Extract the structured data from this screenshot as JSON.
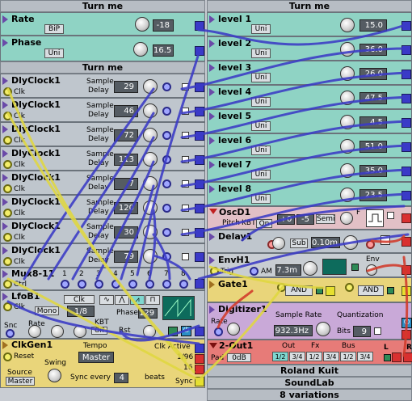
{
  "left_header": "Turn me",
  "right_header": "Turn me",
  "mid_header": "Turn me",
  "rate": {
    "title": "Rate",
    "button": "BiP",
    "value": "-18"
  },
  "phase": {
    "title": "Phase",
    "button": "Uni",
    "value": "16.5"
  },
  "levels": [
    {
      "title": "level 1",
      "button": "Uni",
      "value": "15.0"
    },
    {
      "title": "level 2",
      "button": "Uni",
      "value": "36.0"
    },
    {
      "title": "level 3",
      "button": "Uni",
      "value": "26.0"
    },
    {
      "title": "level 4",
      "button": "Uni",
      "value": "47.5"
    },
    {
      "title": "level 5",
      "button": "Uni",
      "value": "4.5"
    },
    {
      "title": "level 6",
      "button": "Uni",
      "value": "51.0"
    },
    {
      "title": "level 7",
      "button": "Uni",
      "value": "35.0"
    },
    {
      "title": "level 8",
      "button": "Uni",
      "value": "23.5"
    }
  ],
  "dly_clocks": [
    {
      "title": "DlyClock1",
      "clk": "Clk",
      "sample": "Sample",
      "delay": "Delay",
      "value": "29"
    },
    {
      "title": "DlyClock1",
      "clk": "Clk",
      "sample": "Sample",
      "delay": "Delay",
      "value": "46"
    },
    {
      "title": "DlyClock1",
      "clk": "Clk",
      "sample": "Sample",
      "delay": "Delay",
      "value": "72"
    },
    {
      "title": "DlyClock1",
      "clk": "Clk",
      "sample": "Sample",
      "delay": "Delay",
      "value": "113"
    },
    {
      "title": "DlyClock1",
      "clk": "Clk",
      "sample": "Sample",
      "delay": "Delay",
      "value": "7"
    },
    {
      "title": "DlyClock1",
      "clk": "Clk",
      "sample": "Sample",
      "delay": "Delay",
      "value": "120"
    },
    {
      "title": "DlyClock1",
      "clk": "Clk",
      "sample": "Sample",
      "delay": "Delay",
      "value": "30"
    },
    {
      "title": "DlyClock1",
      "clk": "Clk",
      "sample": "Sample",
      "delay": "Delay",
      "value": "79"
    }
  ],
  "mux": {
    "title": "Mux8-11",
    "ctrl": "Ctrl",
    "inputs": [
      "1",
      "2",
      "3",
      "4",
      "5",
      "6",
      "7",
      "8"
    ]
  },
  "lfo": {
    "title": "LfoB1",
    "clk": "Clk",
    "mono": "Mono",
    "rate_val": "1/8",
    "phase_label": "Phase",
    "phase_val": "129",
    "snc": "Snc",
    "rate": "Rate",
    "kbt": "KBT",
    "off": "Off",
    "rst": "Rst"
  },
  "clkgen": {
    "title": "ClkGen1",
    "reset": "Reset",
    "swing": "Swing",
    "tempo": "Tempo",
    "tempo_val": "Master",
    "clk_active": "Clk Active",
    "div": "1/96",
    "div2": "16",
    "source": "Source",
    "source_val": "Master",
    "sync_every": "Sync every",
    "sync_val": "4",
    "beats": "beats",
    "sync": "Sync"
  },
  "osc": {
    "title": "OscD1",
    "pitch": "Pitch",
    "kbt": "KBT",
    "on": "On",
    "v1": "+0",
    "v2": "-5",
    "semi": "Semi",
    "f": "F"
  },
  "delay": {
    "title": "Delay1",
    "sub": "Sub",
    "time": "0.10m"
  },
  "env": {
    "title": "EnvH1",
    "trig": "Trig",
    "am": "AM",
    "time": "7.3m",
    "env": "Env"
  },
  "gate": {
    "title": "Gate1",
    "op1": "AND",
    "op2": "AND"
  },
  "digitizer": {
    "title": "Digitizer1",
    "rate": "Rate",
    "sample_rate": "Sample Rate",
    "sr_val": "932.3Hz",
    "quant": "Quantization",
    "bits": "Bits",
    "bits_val": "9"
  },
  "out": {
    "title": "2-Out1",
    "pad": "Pad",
    "pad_val": "0dB",
    "out": "Out",
    "fx": "Fx",
    "bus": "Bus",
    "opts": [
      "1/2",
      "3/4",
      "1/2",
      "3/4",
      "1/2",
      "3/4"
    ],
    "l": "L",
    "r": "R"
  },
  "footer": [
    "Roland Kuit",
    "SoundLab",
    "8 variations"
  ],
  "colors": {
    "cable_blue": "#3b3bc6",
    "cable_yellow": "#e0d840",
    "cable_red": "#d23a2a",
    "teal": "#8fd3c4"
  }
}
